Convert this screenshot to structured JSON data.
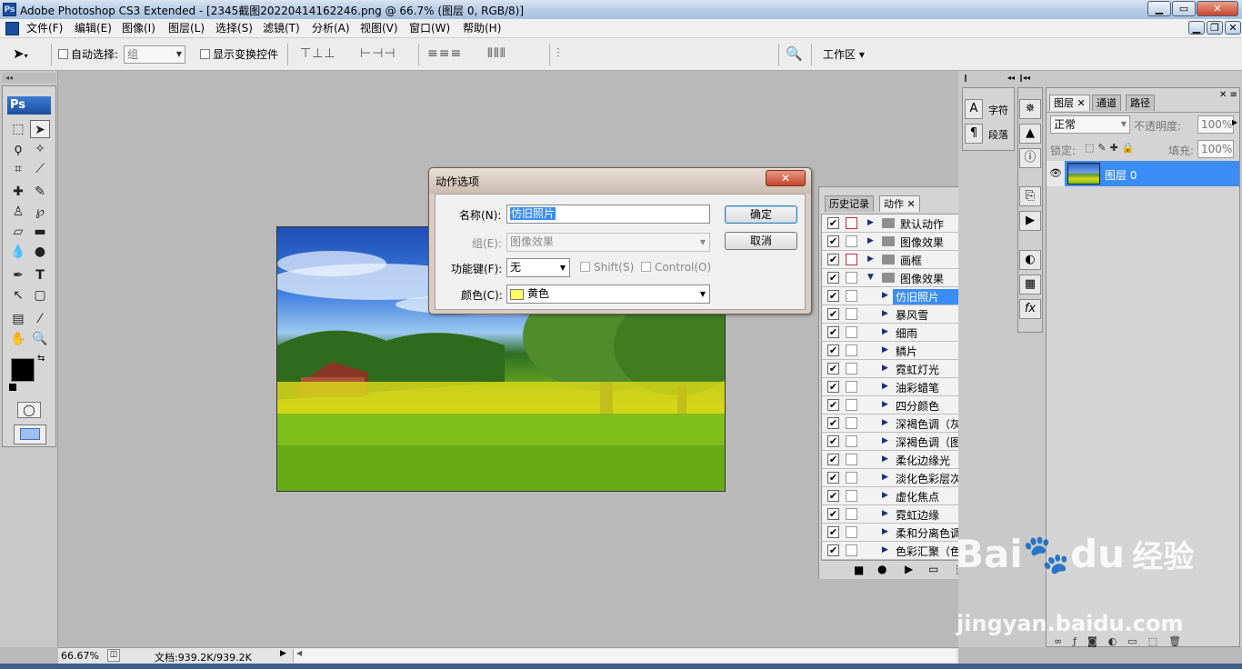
{
  "window": {
    "title": "Adobe Photoshop CS3 Extended - [2345截图20220414162246.png @ 66.7% (图层 0, RGB/8)]",
    "app_icon": "Ps"
  },
  "menu": [
    "文件(F)",
    "编辑(E)",
    "图像(I)",
    "图层(L)",
    "选择(S)",
    "滤镜(T)",
    "分析(A)",
    "视图(V)",
    "窗口(W)",
    "帮助(H)"
  ],
  "options": {
    "auto_select_label": "自动选择:",
    "auto_select_value": "组",
    "show_transform_label": "显示变换控件",
    "workspace_label": "工作区"
  },
  "toolbox": {
    "logo": "Ps"
  },
  "status": {
    "zoom": "66.67%",
    "doc": "文档:939.2K/939.2K"
  },
  "dialog": {
    "title": "动作选项",
    "name_label": "名称(N):",
    "name_value": "仿旧照片",
    "group_label": "组(E):",
    "group_value": "图像效果",
    "fkey_label": "功能键(F):",
    "fkey_value": "无",
    "shift_label": "Shift(S)",
    "control_label": "Control(O)",
    "color_label": "颜色(C):",
    "color_value": "黄色",
    "color_swatch": "#ffff66",
    "ok": "确定",
    "cancel": "取消"
  },
  "actions_panel": {
    "tabs": [
      "历史记录",
      "动作"
    ],
    "sets": [
      {
        "label": "默认动作",
        "open": false,
        "dialog_red": true
      },
      {
        "label": "图像效果",
        "open": false,
        "dialog_red": false
      },
      {
        "label": "画框",
        "open": false,
        "dialog_red": true
      },
      {
        "label": "图像效果",
        "open": true,
        "dialog_red": false
      }
    ],
    "actions": [
      "仿旧照片",
      "暴风雪",
      "细雨",
      "鳞片",
      "霓虹灯光",
      "油彩蜡笔",
      "四分颜色",
      "深褐色调（灰度）",
      "深褐色调（图层）",
      "柔化边缘光",
      "淡化色彩层次",
      "虚化焦点",
      "霓虹边缘",
      "柔和分离色调",
      "色彩汇聚（色彩）"
    ]
  },
  "char_panel": {
    "char": "字符",
    "para": "段落"
  },
  "layers_panel": {
    "tabs": [
      "图层",
      "通道",
      "路径"
    ],
    "blend_mode": "正常",
    "opacity_label": "不透明度:",
    "opacity_value": "100%",
    "lock_label": "锁定:",
    "fill_label": "填充:",
    "fill_value": "100%",
    "layer_name": "图层 0"
  },
  "watermark": {
    "brand": "Bai",
    "brand2": "du",
    "cn": "经验",
    "url": "jingyan.baidu.com"
  }
}
